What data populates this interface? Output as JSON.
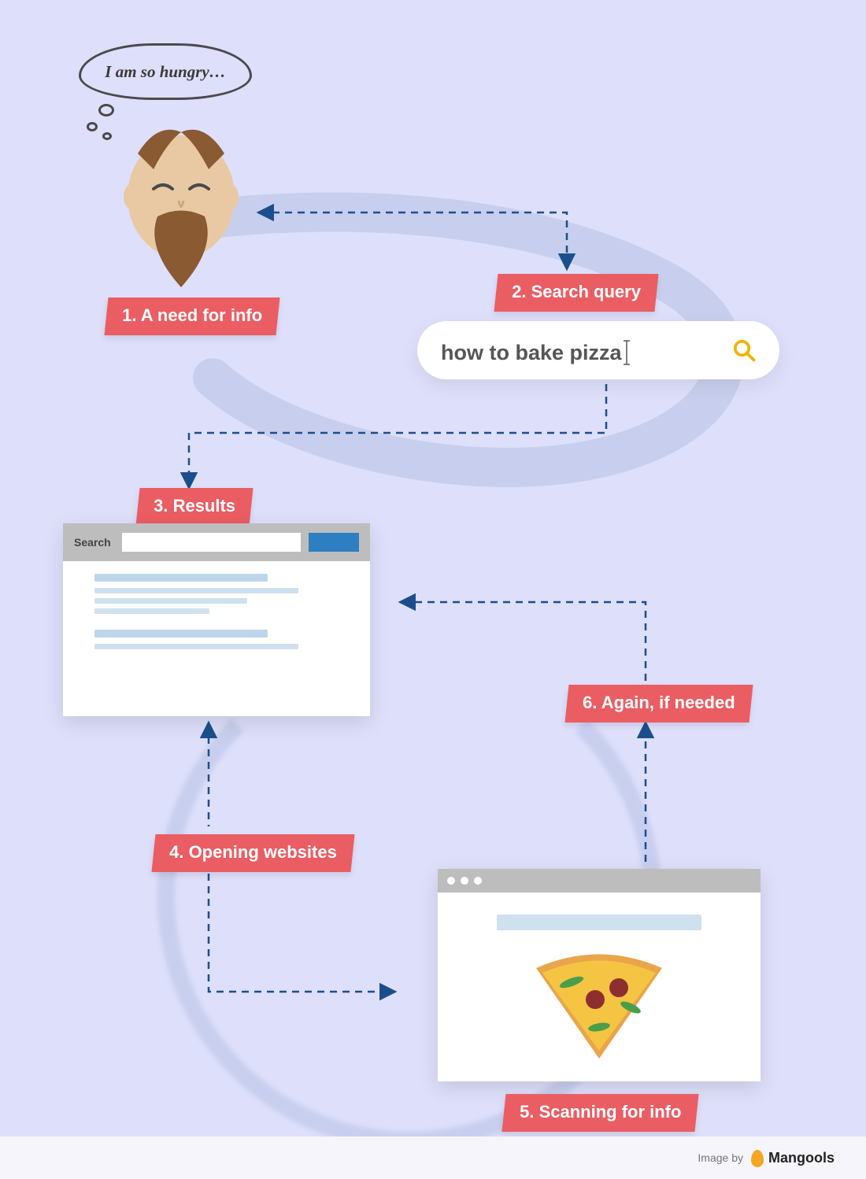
{
  "thought_text": "I am so hungry…",
  "steps": {
    "s1": "1. A need for info",
    "s2": "2. Search query",
    "s3": "3. Results",
    "s4": "4. Opening websites",
    "s5": "5. Scanning for info",
    "s6": "6. Again, if needed"
  },
  "search": {
    "query": "how to bake pizza"
  },
  "serp_label": "Search",
  "footer": {
    "credit": "Image by",
    "brand": "Mangools"
  }
}
